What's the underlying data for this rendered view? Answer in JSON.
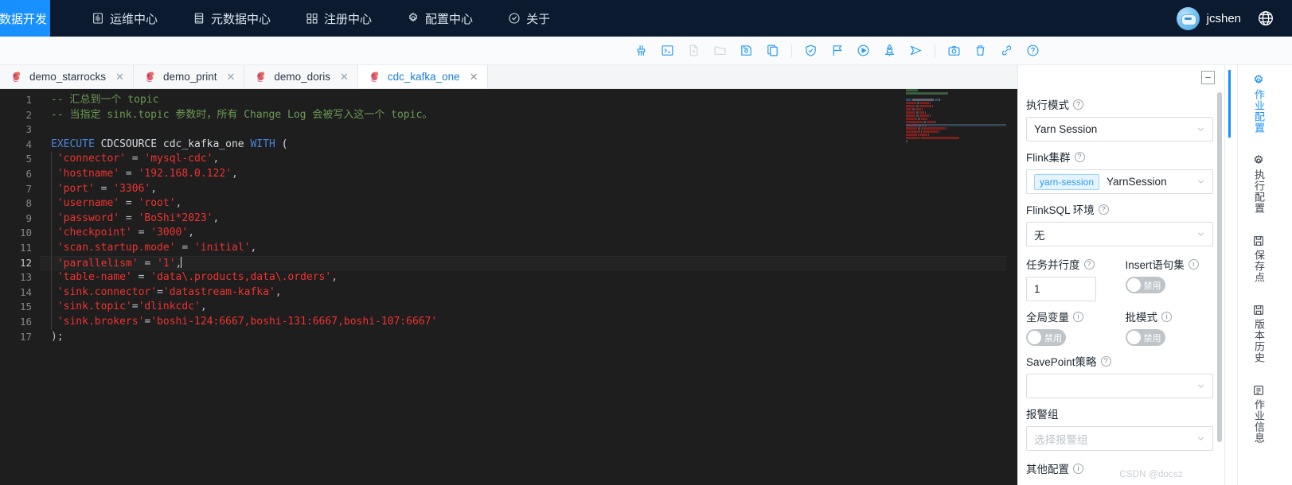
{
  "topnav": {
    "home_tab": "数据开发",
    "items": [
      {
        "label": "运维中心",
        "icon": "ops-center-icon"
      },
      {
        "label": "元数据中心",
        "icon": "metadata-center-icon"
      },
      {
        "label": "注册中心",
        "icon": "registry-center-icon"
      },
      {
        "label": "配置中心",
        "icon": "settings-center-icon"
      },
      {
        "label": "关于",
        "icon": "about-icon"
      }
    ],
    "username": "jcshen",
    "language_icon": "globe-icon"
  },
  "toolbar": {
    "buttons": [
      {
        "name": "format-code-button",
        "icon": "broom-icon",
        "disabled": false
      },
      {
        "name": "console-button",
        "icon": "terminal-icon",
        "disabled": false
      },
      {
        "name": "new-file-button",
        "icon": "file-add-icon",
        "disabled": true
      },
      {
        "name": "open-folder-button",
        "icon": "folder-open-icon",
        "disabled": true
      },
      {
        "name": "save-button",
        "icon": "save-icon",
        "disabled": false
      },
      {
        "name": "copy-button",
        "icon": "copy-icon",
        "disabled": false
      },
      {
        "name": "check-sql-button",
        "icon": "shield-check-icon",
        "disabled": false
      },
      {
        "name": "explain-plan-button",
        "icon": "flag-icon",
        "disabled": false
      },
      {
        "name": "run-button",
        "icon": "play-circle-icon",
        "disabled": false
      },
      {
        "name": "deploy-button",
        "icon": "rocket-icon",
        "disabled": false
      },
      {
        "name": "submit-button",
        "icon": "send-icon",
        "disabled": false
      },
      {
        "name": "snapshot-button",
        "icon": "camera-icon",
        "disabled": false
      },
      {
        "name": "delete-button",
        "icon": "trash-icon",
        "disabled": false
      },
      {
        "name": "api-button",
        "icon": "link-icon",
        "disabled": false
      },
      {
        "name": "help-button",
        "icon": "question-circle-icon",
        "disabled": false
      }
    ]
  },
  "tabs": [
    {
      "label": "demo_starrocks",
      "icon": "flink-squirrel-icon",
      "active": false
    },
    {
      "label": "demo_print",
      "icon": "flink-squirrel-icon",
      "active": false
    },
    {
      "label": "demo_doris",
      "icon": "flink-squirrel-icon",
      "active": false
    },
    {
      "label": "cdc_kafka_one",
      "icon": "flink-squirrel-icon",
      "active": true
    }
  ],
  "editor": {
    "current_line": 12,
    "line_numbers": [
      "1",
      "2",
      "3",
      "4",
      "5",
      "6",
      "7",
      "8",
      "9",
      "10",
      "11",
      "12",
      "13",
      "14",
      "15",
      "16",
      "17"
    ],
    "lines": [
      {
        "n": 1,
        "tokens": [
          {
            "t": "cm",
            "v": "-- 汇总到一个 topic"
          }
        ]
      },
      {
        "n": 2,
        "tokens": [
          {
            "t": "cm",
            "v": "-- 当指定 sink.topic 参数时，所有 Change Log 会被写入这一个 topic。"
          }
        ]
      },
      {
        "n": 3,
        "tokens": [
          {
            "t": "op",
            "v": ""
          }
        ]
      },
      {
        "n": 4,
        "tokens": [
          {
            "t": "kw",
            "v": "EXECUTE"
          },
          {
            "t": "id",
            "v": " CDCSOURCE cdc_kafka_one "
          },
          {
            "t": "kw",
            "v": "WITH"
          },
          {
            "t": "id",
            "v": " ("
          }
        ]
      },
      {
        "n": 5,
        "tokens": [
          {
            "t": "str",
            "v": " 'connector'"
          },
          {
            "t": "op",
            "v": " = "
          },
          {
            "t": "str",
            "v": "'mysql-cdc'"
          },
          {
            "t": "op",
            "v": ","
          }
        ]
      },
      {
        "n": 6,
        "tokens": [
          {
            "t": "str",
            "v": " 'hostname'"
          },
          {
            "t": "op",
            "v": " = "
          },
          {
            "t": "str",
            "v": "'192.168.0.122'"
          },
          {
            "t": "op",
            "v": ","
          }
        ]
      },
      {
        "n": 7,
        "tokens": [
          {
            "t": "str",
            "v": " 'port'"
          },
          {
            "t": "op",
            "v": " = "
          },
          {
            "t": "str",
            "v": "'3306'"
          },
          {
            "t": "op",
            "v": ","
          }
        ]
      },
      {
        "n": 8,
        "tokens": [
          {
            "t": "str",
            "v": " 'username'"
          },
          {
            "t": "op",
            "v": " = "
          },
          {
            "t": "str",
            "v": "'root'"
          },
          {
            "t": "op",
            "v": ","
          }
        ]
      },
      {
        "n": 9,
        "tokens": [
          {
            "t": "str",
            "v": " 'password'"
          },
          {
            "t": "op",
            "v": " = "
          },
          {
            "t": "str",
            "v": "'BoShi*2023'"
          },
          {
            "t": "op",
            "v": ","
          }
        ]
      },
      {
        "n": 10,
        "tokens": [
          {
            "t": "str",
            "v": " 'checkpoint'"
          },
          {
            "t": "op",
            "v": " = "
          },
          {
            "t": "str",
            "v": "'3000'"
          },
          {
            "t": "op",
            "v": ","
          }
        ]
      },
      {
        "n": 11,
        "tokens": [
          {
            "t": "str",
            "v": " 'scan.startup.mode'"
          },
          {
            "t": "op",
            "v": " = "
          },
          {
            "t": "str",
            "v": "'initial'"
          },
          {
            "t": "op",
            "v": ","
          }
        ]
      },
      {
        "n": 12,
        "tokens": [
          {
            "t": "str",
            "v": " 'parallelism'"
          },
          {
            "t": "op",
            "v": " = "
          },
          {
            "t": "str",
            "v": "'1'"
          },
          {
            "t": "op",
            "v": ","
          }
        ]
      },
      {
        "n": 13,
        "tokens": [
          {
            "t": "str",
            "v": " 'table-name'"
          },
          {
            "t": "op",
            "v": " = "
          },
          {
            "t": "str",
            "v": "'data\\.products,data\\.orders'"
          },
          {
            "t": "op",
            "v": ","
          }
        ]
      },
      {
        "n": 14,
        "tokens": [
          {
            "t": "str",
            "v": " 'sink.connector'"
          },
          {
            "t": "op",
            "v": "="
          },
          {
            "t": "str",
            "v": "'datastream-kafka'"
          },
          {
            "t": "op",
            "v": ","
          }
        ]
      },
      {
        "n": 15,
        "tokens": [
          {
            "t": "str",
            "v": " 'sink.topic'"
          },
          {
            "t": "op",
            "v": "="
          },
          {
            "t": "str",
            "v": "'dlinkcdc'"
          },
          {
            "t": "op",
            "v": ","
          }
        ]
      },
      {
        "n": 16,
        "tokens": [
          {
            "t": "str",
            "v": " 'sink.brokers'"
          },
          {
            "t": "op",
            "v": "="
          },
          {
            "t": "str",
            "v": "'boshi-124:6667,boshi-131:6667,boshi-107:6667'"
          }
        ]
      },
      {
        "n": 17,
        "tokens": [
          {
            "t": "op",
            "v": ");"
          }
        ]
      }
    ]
  },
  "config_panel": {
    "collapse_label": "−",
    "exec_mode": {
      "label": "执行模式",
      "value": "Yarn Session",
      "help": "?"
    },
    "flink_cluster": {
      "label": "Flink集群",
      "tag": "yarn-session",
      "value": "YarnSession",
      "help": "?"
    },
    "flinksql_env": {
      "label": "FlinkSQL 环境",
      "value": "无",
      "help": "?"
    },
    "parallelism": {
      "label": "任务并行度",
      "value": "1",
      "help": "?"
    },
    "insert_stmt_set": {
      "label": "Insert语句集",
      "switch": "禁用",
      "help": "i"
    },
    "global_var": {
      "label": "全局变量",
      "switch": "禁用",
      "help": "i"
    },
    "batch_mode": {
      "label": "批模式",
      "switch": "禁用",
      "help": "i"
    },
    "savepoint_strategy": {
      "label": "SavePoint策略",
      "value": "",
      "help": "?"
    },
    "alert_group": {
      "label": "报警组",
      "placeholder": "选择报警组"
    },
    "other_config": {
      "label": "其他配置",
      "help": "i"
    },
    "watermark": "CSDN @docsz"
  },
  "vertical_tabs": [
    {
      "label": "作业配置",
      "icon": "gear-icon",
      "active": true
    },
    {
      "label": "执行配置",
      "icon": "gear-icon",
      "active": false
    },
    {
      "label": "保存点",
      "icon": "save-point-icon",
      "active": false
    },
    {
      "label": "版本历史",
      "icon": "history-icon",
      "active": false
    },
    {
      "label": "作业信息",
      "icon": "info-panel-icon",
      "active": false
    }
  ]
}
